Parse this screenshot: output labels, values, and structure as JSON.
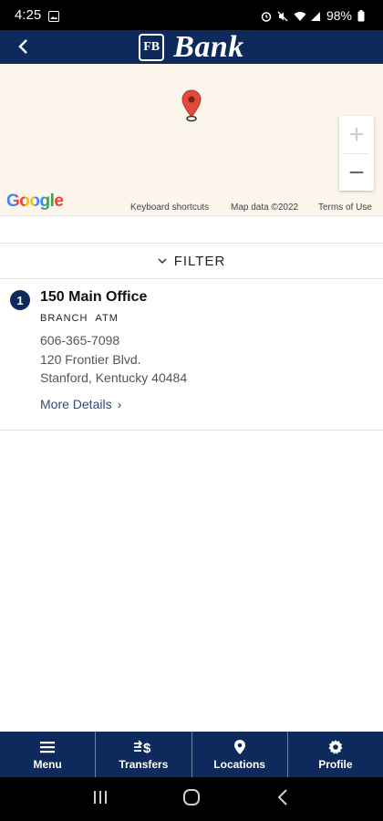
{
  "status_bar": {
    "time": "4:25",
    "battery": "98%"
  },
  "header": {
    "back_icon": "chevron-left-icon",
    "logo_mark": "FB",
    "brand_name": "Bank"
  },
  "map": {
    "google_label": "Google",
    "footer": [
      "Keyboard shortcuts",
      "Map data ©2022",
      "Terms of Use"
    ],
    "zoom_in": "+",
    "zoom_out": "−",
    "pin_color": "#e2493b"
  },
  "filter": {
    "label": "FILTER"
  },
  "location": {
    "number": "1",
    "name": "150 Main Office",
    "types": [
      "BRANCH",
      "ATM"
    ],
    "phone": "606-365-7098",
    "address_line1": "120 Frontier Blvd.",
    "address_line2": "Stanford, Kentucky 40484",
    "more_details": "More Details",
    "more_chevron": "›"
  },
  "bottom_nav": [
    {
      "label": "Menu",
      "icon": "menu-icon"
    },
    {
      "label": "Transfers",
      "icon": "transfer-icon"
    },
    {
      "label": "Locations",
      "icon": "location-pin-icon"
    },
    {
      "label": "Profile",
      "icon": "gear-icon"
    }
  ],
  "colors": {
    "brand_navy": "#0e2a5c",
    "map_bg": "#fbf5ec",
    "link": "#2f4b7c"
  }
}
